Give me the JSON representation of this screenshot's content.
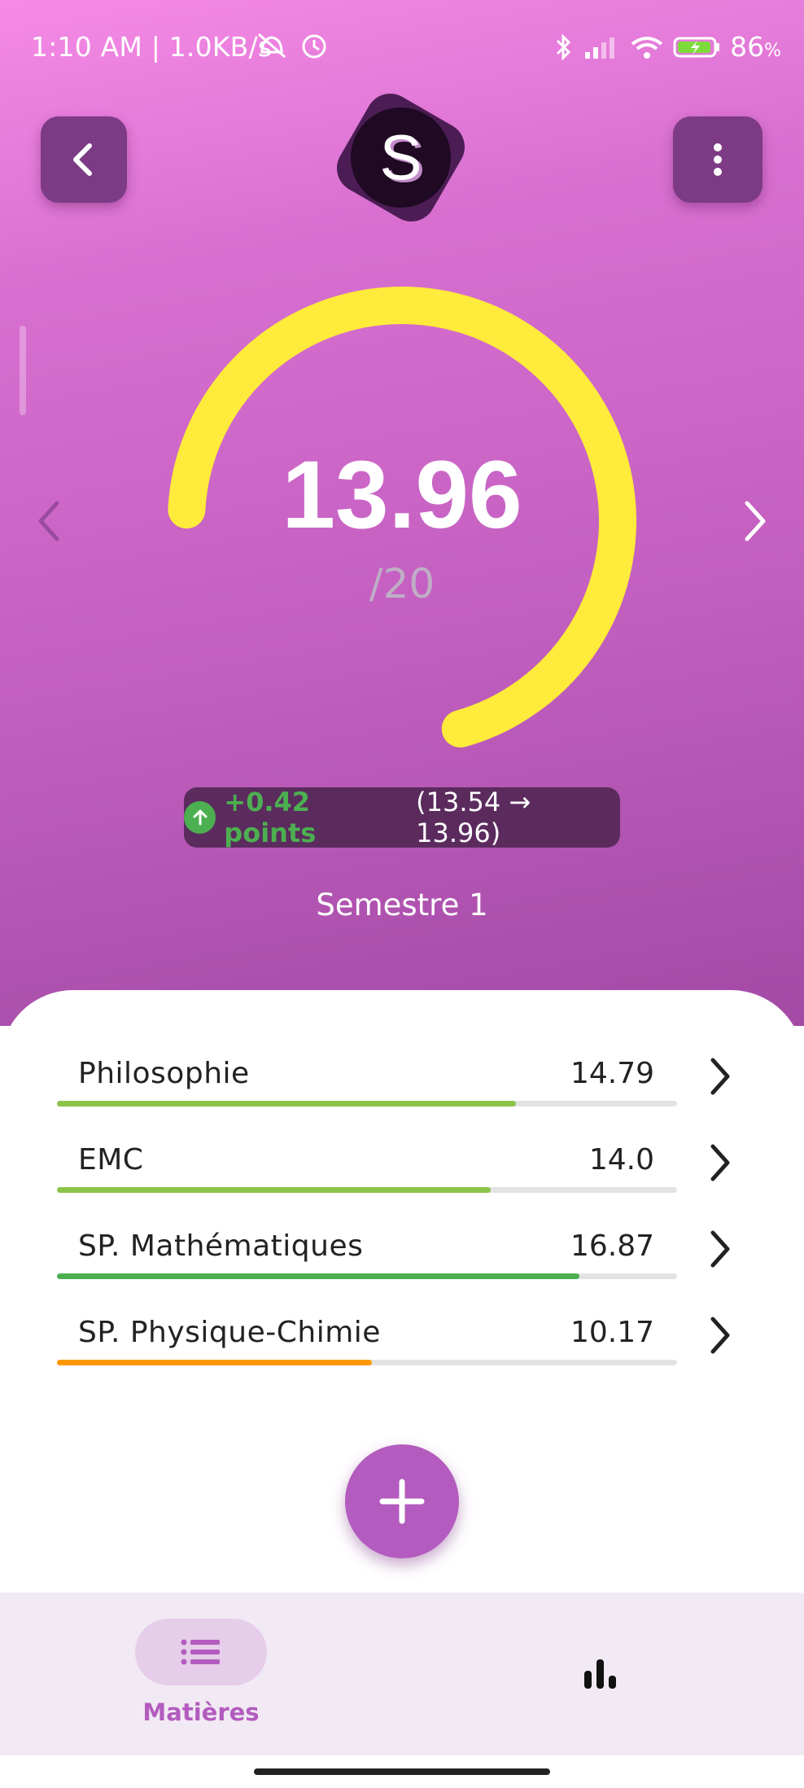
{
  "status_bar": {
    "time_speed": "1:10 AM | 1.0KB/s",
    "battery": "86",
    "battery_unit": "%"
  },
  "logo": {
    "letter": "S"
  },
  "average": {
    "value": "13.96",
    "out_of": "/20",
    "progress_fraction": 0.698
  },
  "change": {
    "points": "+0.42 points",
    "detail": "(13.54 → 13.96)"
  },
  "period": "Semestre 1",
  "subjects": [
    {
      "name": "Philosophie",
      "grade": "14.79",
      "fraction": 0.74,
      "color": "#8bc34a"
    },
    {
      "name": "EMC",
      "grade": "14.0",
      "fraction": 0.7,
      "color": "#8bc34a"
    },
    {
      "name": "SP. Mathématiques",
      "grade": "16.87",
      "fraction": 0.843,
      "color": "#4caf50"
    },
    {
      "name": "SP. Physique-Chimie",
      "grade": "10.17",
      "fraction": 0.508,
      "color": "#ff9800"
    }
  ],
  "bottom_nav": {
    "tab1_label": "Matières",
    "tab1_icon": "list-icon",
    "tab2_icon": "bar-chart-icon"
  },
  "colors": {
    "gauge": "#ffeb3b",
    "accent": "#b35bbf",
    "positive": "#4caf50"
  }
}
